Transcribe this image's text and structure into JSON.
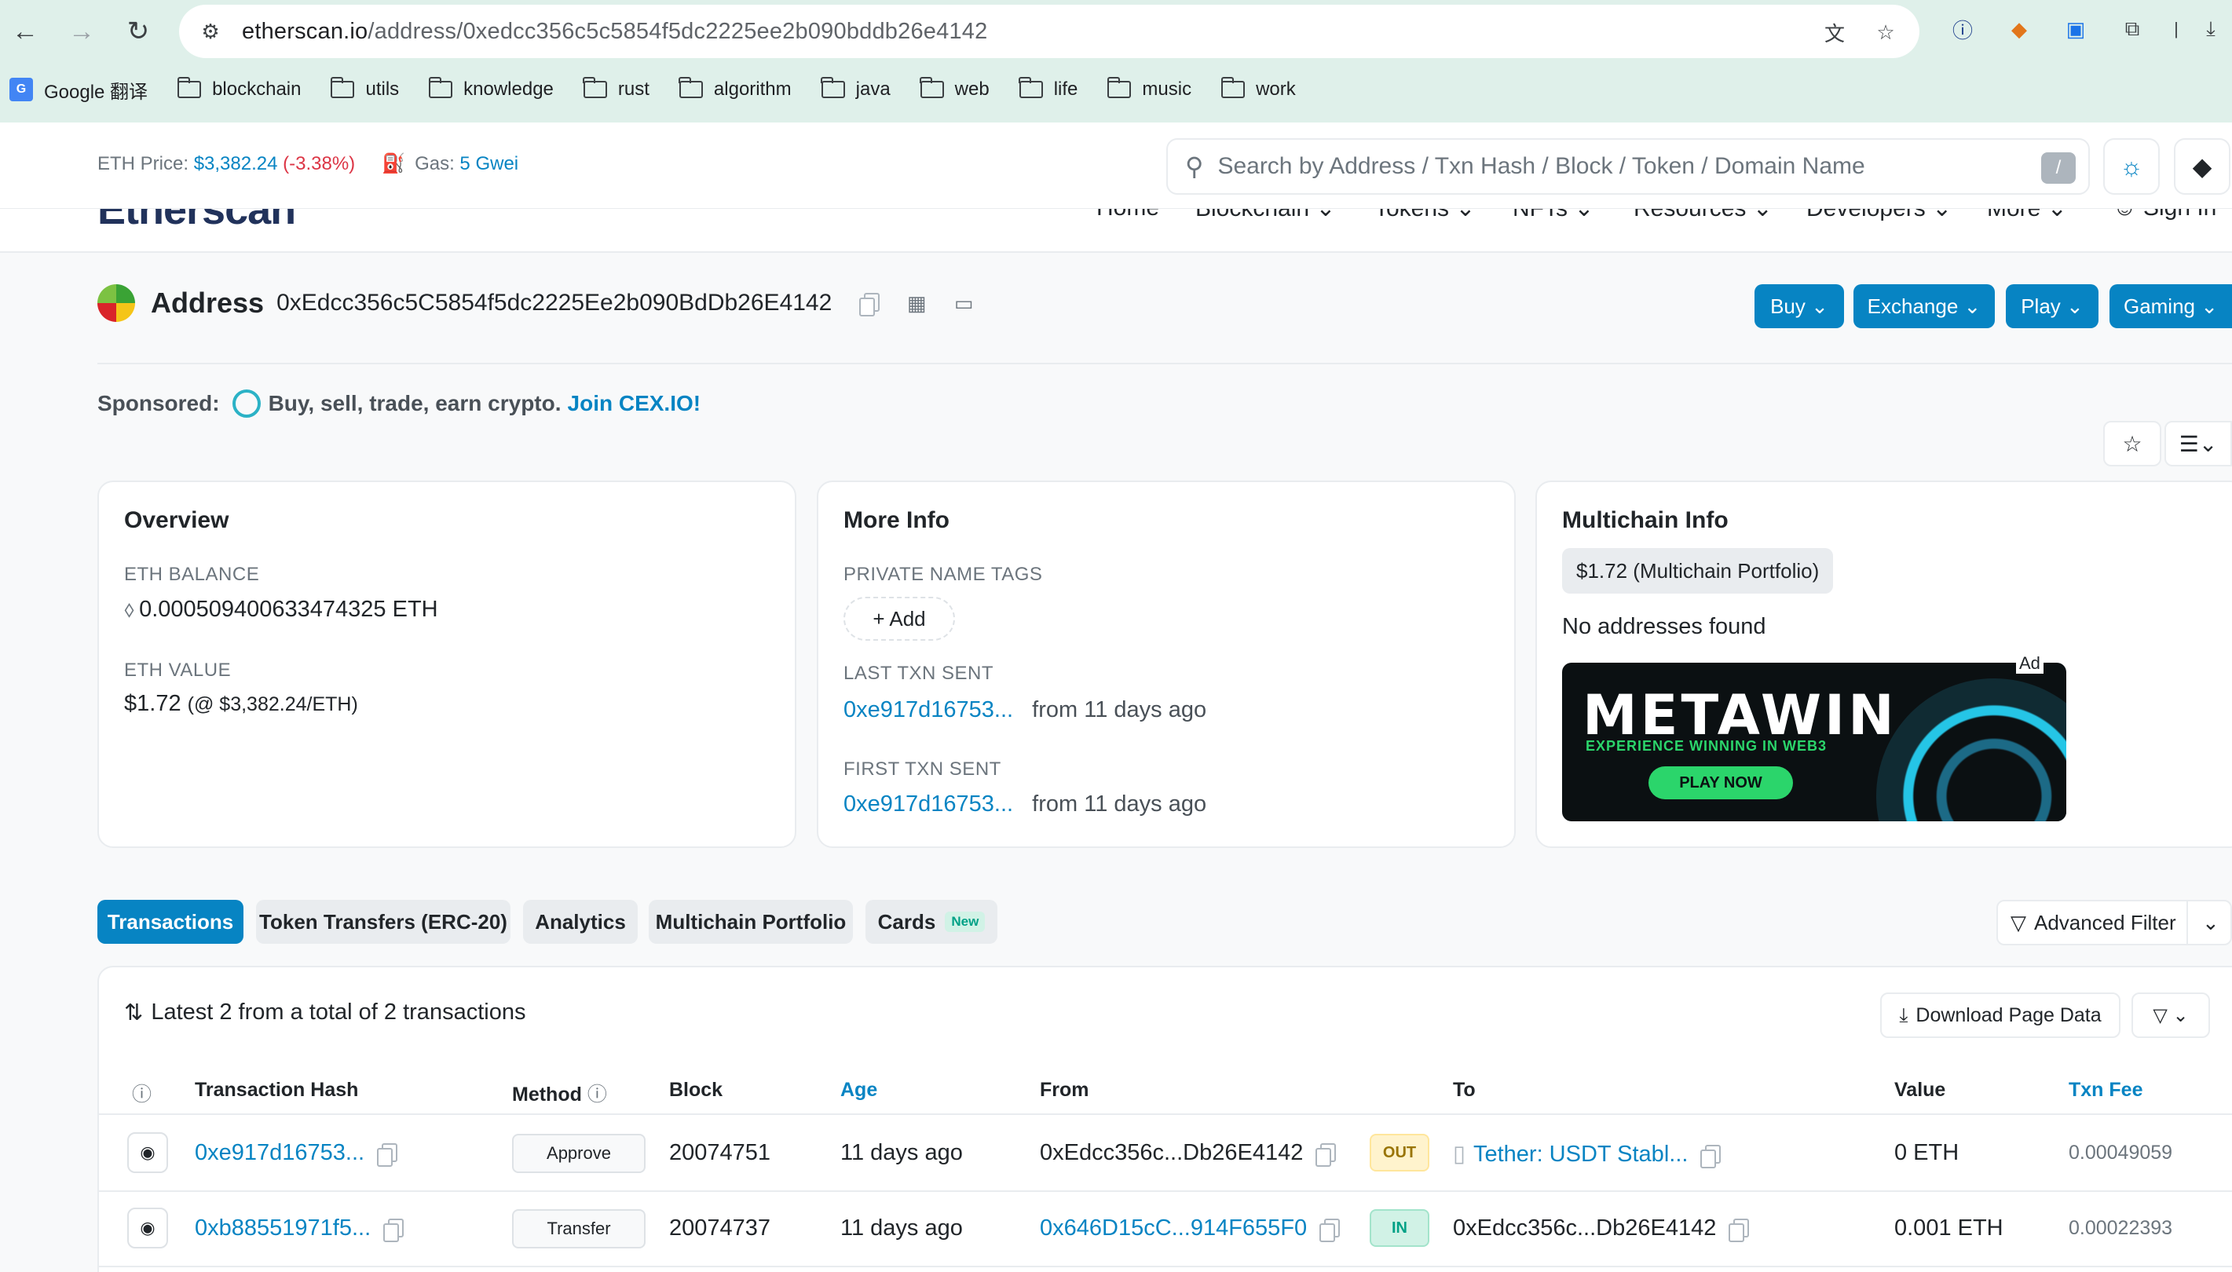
{
  "browser": {
    "url_host": "etherscan.io",
    "url_path": "/address/0xedcc356c5c5854f5dc2225ee2b090bddb26e4142",
    "bookmarks": [
      "Google 翻译",
      "blockchain",
      "utils",
      "knowledge",
      "rust",
      "algorithm",
      "java",
      "web",
      "life",
      "music",
      "work"
    ]
  },
  "header": {
    "eth_price_label": "ETH Price:",
    "eth_price": "$3,382.24",
    "eth_change": "(-3.38%)",
    "gas_label": "Gas:",
    "gas_value": "5 Gwei",
    "search_placeholder": "Search by Address / Txn Hash / Block / Token / Domain Name",
    "search_shortcut": "/",
    "logo_text": "Etherscan",
    "nav": [
      "Home",
      "Blockchain",
      "Tokens",
      "NFTs",
      "Resources",
      "Developers",
      "More",
      "Sign In"
    ]
  },
  "address": {
    "label": "Address",
    "hash": "0xEdcc356c5C5854f5dc2225Ee2b090BdDb26E4142",
    "buttons": [
      "Buy",
      "Exchange",
      "Play",
      "Gaming"
    ]
  },
  "sponsor": {
    "label": "Sponsored:",
    "text": "Buy, sell, trade, earn crypto.",
    "cta": "Join CEX.IO!"
  },
  "overview": {
    "title": "Overview",
    "balance_label": "ETH BALANCE",
    "balance": "0.000509400633474325 ETH",
    "value_label": "ETH VALUE",
    "value": "$1.72",
    "value_rate": "(@ $3,382.24/ETH)"
  },
  "more_info": {
    "title": "More Info",
    "tags_label": "PRIVATE NAME TAGS",
    "add_label": "+ Add",
    "last_label": "LAST TXN SENT",
    "last_hash": "0xe917d16753...",
    "last_when": "from 11 days ago",
    "first_label": "FIRST TXN SENT",
    "first_hash": "0xe917d16753...",
    "first_when": "from 11 days ago"
  },
  "multichain": {
    "title": "Multichain Info",
    "portfolio": "$1.72 (Multichain Portfolio)",
    "none": "No addresses found",
    "ad_tag": "Ad",
    "ad_brand": "METAWIN",
    "ad_sub": "EXPERIENCE WINNING IN WEB3",
    "ad_cta": "PLAY NOW"
  },
  "tabs": {
    "items": [
      "Transactions",
      "Token Transfers (ERC-20)",
      "Analytics",
      "Multichain Portfolio",
      "Cards"
    ],
    "new_badge": "New",
    "advanced_filter": "Advanced Filter"
  },
  "table": {
    "summary": "Latest 2 from a total of 2 transactions",
    "download": "Download Page Data",
    "headers": [
      "Transaction Hash",
      "Method",
      "Block",
      "Age",
      "From",
      "To",
      "Value",
      "Txn Fee"
    ],
    "rows": [
      {
        "hash": "0xe917d16753...",
        "method": "Approve",
        "block": "20074751",
        "age": "11 days ago",
        "from": "0xEdcc356c...Db26E4142",
        "dir": "OUT",
        "to": "Tether: USDT Stabl...",
        "value": "0 ETH",
        "fee": "0.00049059"
      },
      {
        "hash": "0xb88551971f5...",
        "method": "Transfer",
        "block": "20074737",
        "age": "11 days ago",
        "from": "0x646D15cC...914F655F0",
        "dir": "IN",
        "to": "0xEdcc356c...Db26E4142",
        "value": "0.001 ETH",
        "fee": "0.00022393"
      }
    ]
  },
  "colors": {
    "accent": "#0784c3",
    "negative": "#dc3545",
    "chrome": "#dff0ea"
  }
}
